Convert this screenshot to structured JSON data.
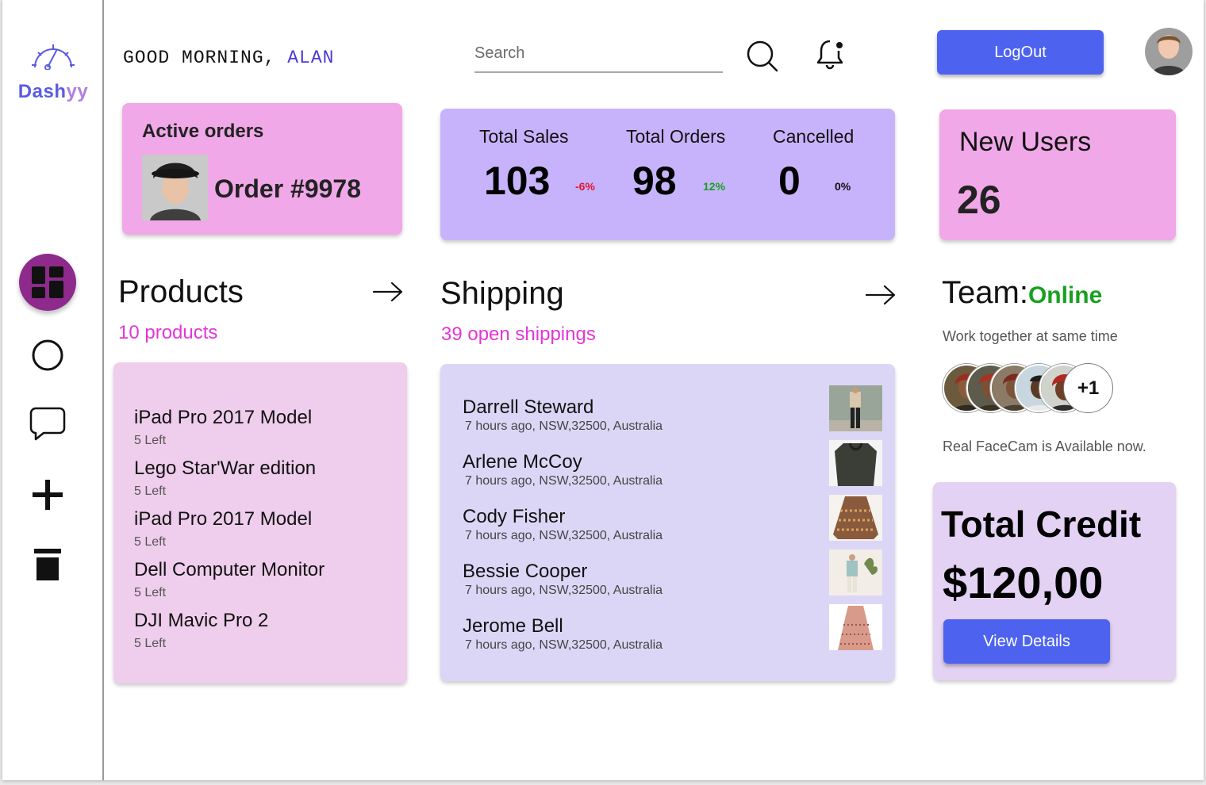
{
  "brand": {
    "name_part1": "Dash",
    "name_part2": "yy"
  },
  "header": {
    "greeting": "GOOD MORNING,",
    "user_name": "ALAN",
    "search_placeholder": "Search",
    "logout_label": "LogOut"
  },
  "sidebar": {
    "items": [
      {
        "name": "dashboard",
        "icon": "grid-icon",
        "active": true
      },
      {
        "name": "circle",
        "icon": "circle-icon",
        "active": false
      },
      {
        "name": "messages",
        "icon": "chat-bubble-icon",
        "active": false
      },
      {
        "name": "add",
        "icon": "plus-icon",
        "active": false
      },
      {
        "name": "delete",
        "icon": "trash-icon",
        "active": false
      }
    ]
  },
  "active_orders": {
    "title": "Active orders",
    "order": "Order #9978"
  },
  "totals": {
    "sales": {
      "label": "Total Sales",
      "value": "103",
      "change": "-6%"
    },
    "orders": {
      "label": "Total Orders",
      "value": "98",
      "change": "12%"
    },
    "cancelled": {
      "label": "Cancelled",
      "value": "0",
      "change": "0%"
    }
  },
  "new_users": {
    "title": "New Users",
    "value": "26"
  },
  "products": {
    "title": "Products",
    "subtitle": "10 products",
    "items": [
      {
        "name": "iPad Pro 2017 Model",
        "stock": "5 Left"
      },
      {
        "name": "Lego Star'War edition",
        "stock": "5 Left"
      },
      {
        "name": "iPad Pro 2017 Model",
        "stock": "5 Left"
      },
      {
        "name": "Dell Computer Monitor",
        "stock": "5 Left"
      },
      {
        "name": "DJI Mavic Pro 2",
        "stock": "5 Left"
      }
    ]
  },
  "shipping": {
    "title": "Shipping",
    "subtitle": "39 open shippings",
    "items": [
      {
        "name": "Darrell Steward",
        "meta": "7 hours ago, NSW,32500, Australia"
      },
      {
        "name": "Arlene McCoy",
        "meta": "7 hours ago, NSW,32500, Australia"
      },
      {
        "name": "Cody Fisher",
        "meta": "7 hours ago, NSW,32500, Australia"
      },
      {
        "name": "Bessie Cooper",
        "meta": "7 hours ago, NSW,32500, Australia"
      },
      {
        "name": "Jerome Bell",
        "meta": "7 hours ago, NSW,32500, Australia"
      }
    ]
  },
  "team": {
    "title": "Team:",
    "status": "Online",
    "subtitle": "Work together at same time",
    "more": "+1",
    "note": "Real FaceCam is Available now."
  },
  "credit": {
    "title": "Total Credit",
    "amount": "$120,00",
    "button": "View Details"
  },
  "colors": {
    "accent_blue": "#4d63ef",
    "active_nav": "#8e2a8c",
    "pink_card": "#f0a8e8",
    "purple_card": "#c7b3fb",
    "magenta_text": "#e336d8",
    "negative": "#e0182d",
    "positive": "#18a11f",
    "online": "#18a11f"
  }
}
